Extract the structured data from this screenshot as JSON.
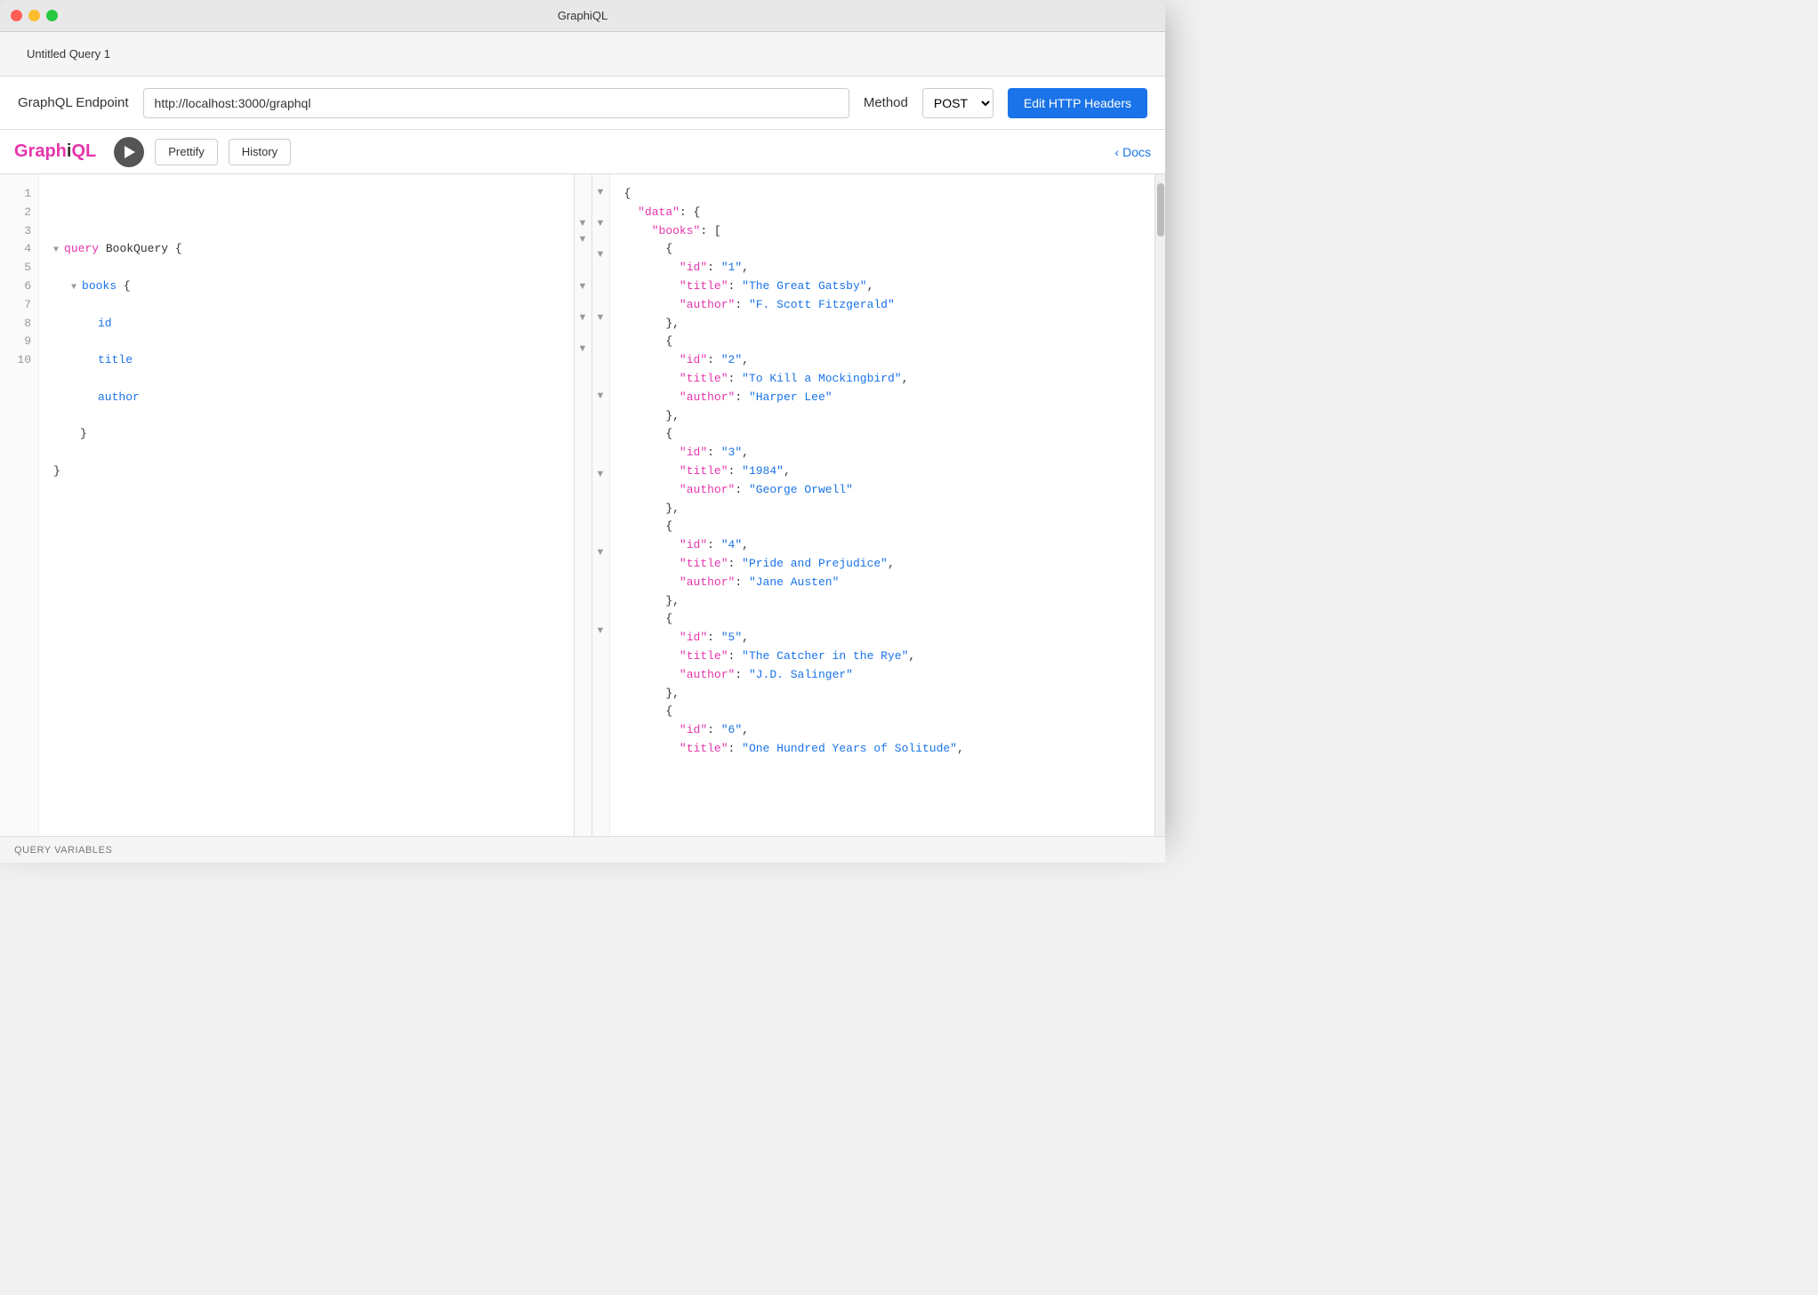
{
  "titleBar": {
    "title": "GraphiQL"
  },
  "tabBar": {
    "activeTab": "Untitled Query 1"
  },
  "endpointBar": {
    "label": "GraphQL Endpoint",
    "endpointValue": "http://localhost:3000/graphql",
    "methodLabel": "Method",
    "methodValue": "POST",
    "editHeadersLabel": "Edit HTTP Headers"
  },
  "toolbar": {
    "logo": "GraphiQL",
    "prettifyLabel": "Prettify",
    "historyLabel": "History",
    "docsLabel": "Docs"
  },
  "queryEditor": {
    "lines": [
      {
        "num": 1,
        "content": "",
        "indent": 0
      },
      {
        "num": 2,
        "content": "",
        "indent": 0
      },
      {
        "num": 3,
        "content": "query BookQuery {",
        "indent": 0,
        "hasFold": true
      },
      {
        "num": 4,
        "content": "books {",
        "indent": 2,
        "hasFold": true
      },
      {
        "num": 5,
        "content": "id",
        "indent": 4
      },
      {
        "num": 6,
        "content": "title",
        "indent": 4
      },
      {
        "num": 7,
        "content": "author",
        "indent": 4
      },
      {
        "num": 8,
        "content": "}",
        "indent": 2
      },
      {
        "num": 9,
        "content": "}",
        "indent": 0
      },
      {
        "num": 10,
        "content": "",
        "indent": 0
      }
    ]
  },
  "responsePanel": {
    "content": [
      {
        "text": "{",
        "type": "brace"
      },
      {
        "text": "  \"data\": {",
        "type": "key-brace"
      },
      {
        "text": "    \"books\": [",
        "type": "key-bracket"
      },
      {
        "text": "      {",
        "type": "brace"
      },
      {
        "text": "        \"id\": \"1\",",
        "type": "entry"
      },
      {
        "text": "        \"title\": \"The Great Gatsby\",",
        "type": "entry"
      },
      {
        "text": "        \"author\": \"F. Scott Fitzgerald\"",
        "type": "entry"
      },
      {
        "text": "      },",
        "type": "brace"
      },
      {
        "text": "      {",
        "type": "brace"
      },
      {
        "text": "        \"id\": \"2\",",
        "type": "entry"
      },
      {
        "text": "        \"title\": \"To Kill a Mockingbird\",",
        "type": "entry"
      },
      {
        "text": "        \"author\": \"Harper Lee\"",
        "type": "entry"
      },
      {
        "text": "      },",
        "type": "brace"
      },
      {
        "text": "      {",
        "type": "brace"
      },
      {
        "text": "        \"id\": \"3\",",
        "type": "entry"
      },
      {
        "text": "        \"title\": \"1984\",",
        "type": "entry"
      },
      {
        "text": "        \"author\": \"George Orwell\"",
        "type": "entry"
      },
      {
        "text": "      },",
        "type": "brace"
      },
      {
        "text": "      {",
        "type": "brace"
      },
      {
        "text": "        \"id\": \"4\",",
        "type": "entry"
      },
      {
        "text": "        \"title\": \"Pride and Prejudice\",",
        "type": "entry"
      },
      {
        "text": "        \"author\": \"Jane Austen\"",
        "type": "entry"
      },
      {
        "text": "      },",
        "type": "brace"
      },
      {
        "text": "      {",
        "type": "brace"
      },
      {
        "text": "        \"id\": \"5\",",
        "type": "entry"
      },
      {
        "text": "        \"title\": \"The Catcher in the Rye\",",
        "type": "entry"
      },
      {
        "text": "        \"author\": \"J.D. Salinger\"",
        "type": "entry"
      },
      {
        "text": "      },",
        "type": "brace"
      },
      {
        "text": "      {",
        "type": "brace"
      },
      {
        "text": "        \"id\": \"6\",",
        "type": "entry"
      },
      {
        "text": "        \"title\": \"One Hundred Years of Solitude\",",
        "type": "entry"
      }
    ]
  },
  "bottomBar": {
    "label": "Query Variables"
  }
}
